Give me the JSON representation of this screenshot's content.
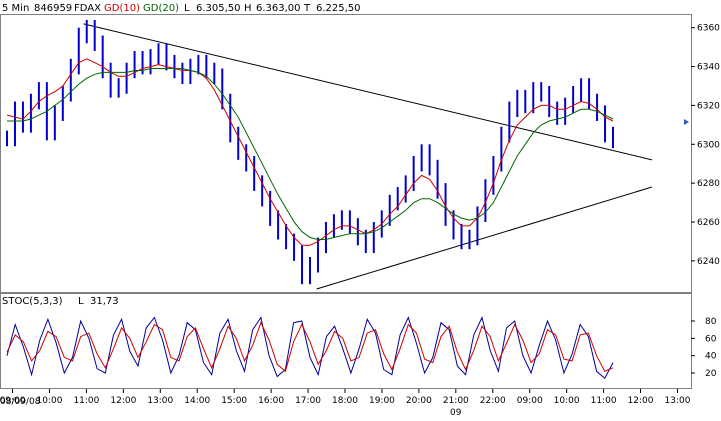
{
  "header": {
    "interval": "5 Min",
    "code": "846959",
    "symbol": "FDAX",
    "ma_fast_label": "GD(10)",
    "ma_slow_label": "GD(20)",
    "low_label": "L",
    "low_value": "6.305,50",
    "high_label": "H",
    "high_value": "6.363,00",
    "last_label": "T",
    "last_value": "6.225,50"
  },
  "stoch_header": {
    "label": "STOC(5,3,3)",
    "last_label": "L",
    "last_value": "31,73"
  },
  "colors": {
    "price": "#0000cc",
    "ma_fast": "#cc0000",
    "ma_slow": "#006600",
    "stoch_k": "#000099",
    "stoch_d": "#cc0000",
    "trendline": "#000000",
    "marker": "#3355cc"
  },
  "date_labels": {
    "left": "08/09/08",
    "mid": "09"
  },
  "chart_data": [
    {
      "type": "line",
      "title": "",
      "x": [
        "09:00",
        "10:00",
        "11:00",
        "12:00",
        "13:00",
        "14:00",
        "15:00",
        "16:00",
        "17:00",
        "18:00",
        "19:00",
        "20:00",
        "21:00",
        "22:00",
        "09:00",
        "10:00",
        "11:00",
        "12:00",
        "13:00"
      ],
      "series": [
        {
          "name": "FDAX",
          "style": "price",
          "values": [
            6303,
            6318,
            6310,
            6322,
            6328,
            6306,
            6316,
            6326,
            6340,
            6356,
            6360,
            6352,
            6338,
            6328,
            6330,
            6338,
            6344,
            6340,
            6345,
            6348,
            6342,
            6338,
            6335,
            6340,
            6342,
            6338,
            6335,
            6322,
            6305,
            6296,
            6290,
            6280,
            6272,
            6262,
            6255,
            6250,
            6244,
            6232,
            6238,
            6248,
            6256,
            6260,
            6262,
            6258,
            6252,
            6248,
            6256,
            6262,
            6270,
            6274,
            6280,
            6290,
            6296,
            6288,
            6276,
            6262,
            6255,
            6250,
            6252,
            6264,
            6278,
            6290,
            6305,
            6318,
            6324,
            6320,
            6328,
            6326,
            6318,
            6314,
            6320,
            6326,
            6330,
            6322,
            6316,
            6305,
            6302
          ]
        },
        {
          "name": "GD(10)",
          "style": "ma_fast",
          "values": [
            6315,
            6314,
            6313,
            6317,
            6322,
            6325,
            6327,
            6330,
            6336,
            6342,
            6344,
            6342,
            6340,
            6337,
            6335,
            6335,
            6337,
            6339,
            6340,
            6341,
            6340,
            6339,
            6338,
            6338,
            6337,
            6334,
            6328,
            6320,
            6312,
            6304,
            6296,
            6288,
            6280,
            6272,
            6265,
            6258,
            6252,
            6248,
            6248,
            6250,
            6253,
            6256,
            6258,
            6258,
            6256,
            6254,
            6256,
            6259,
            6264,
            6268,
            6274,
            6280,
            6284,
            6282,
            6276,
            6268,
            6262,
            6258,
            6258,
            6262,
            6270,
            6280,
            6292,
            6302,
            6310,
            6314,
            6318,
            6320,
            6320,
            6318,
            6318,
            6320,
            6322,
            6321,
            6318,
            6314,
            6312
          ]
        },
        {
          "name": "GD(20)",
          "style": "ma_slow",
          "values": [
            6312,
            6312,
            6312,
            6313,
            6315,
            6317,
            6320,
            6323,
            6327,
            6331,
            6334,
            6336,
            6337,
            6337,
            6337,
            6337,
            6338,
            6338,
            6339,
            6339,
            6339,
            6339,
            6339,
            6338,
            6337,
            6335,
            6331,
            6326,
            6320,
            6314,
            6306,
            6298,
            6290,
            6282,
            6274,
            6267,
            6260,
            6255,
            6252,
            6251,
            6251,
            6252,
            6253,
            6254,
            6254,
            6254,
            6255,
            6257,
            6260,
            6263,
            6266,
            6270,
            6272,
            6272,
            6270,
            6267,
            6264,
            6262,
            6261,
            6262,
            6265,
            6270,
            6278,
            6286,
            6294,
            6300,
            6306,
            6310,
            6312,
            6313,
            6314,
            6316,
            6318,
            6318,
            6317,
            6315,
            6313
          ]
        }
      ],
      "ylim": [
        6225,
        6365
      ],
      "yticks": [
        6240,
        6260,
        6280,
        6300,
        6320,
        6340,
        6360
      ],
      "trendlines": [
        {
          "name": "upper",
          "from": {
            "t": 14,
            "v": 6362
          },
          "to": {
            "t": 114,
            "v": 6292
          }
        },
        {
          "name": "lower",
          "from": {
            "t": 55,
            "v": 6225.5
          },
          "to": {
            "t": 114,
            "v": 6278
          }
        }
      ],
      "grid": false,
      "legend": "top-left"
    },
    {
      "type": "line",
      "title": "",
      "x": [
        "09:00",
        "10:00",
        "11:00",
        "12:00",
        "13:00",
        "14:00",
        "15:00",
        "16:00",
        "17:00",
        "18:00",
        "19:00",
        "20:00",
        "21:00",
        "22:00",
        "09:00",
        "10:00",
        "11:00",
        "12:00",
        "13:00"
      ],
      "series": [
        {
          "name": "%K",
          "style": "stoch_k",
          "values": [
            40,
            76,
            50,
            18,
            58,
            82,
            55,
            20,
            38,
            80,
            60,
            25,
            20,
            64,
            82,
            45,
            28,
            72,
            84,
            58,
            20,
            40,
            78,
            70,
            32,
            18,
            66,
            82,
            46,
            22,
            70,
            84,
            40,
            16,
            24,
            78,
            80,
            38,
            18,
            62,
            74,
            48,
            20,
            48,
            82,
            66,
            24,
            18,
            64,
            84,
            54,
            20,
            38,
            78,
            70,
            28,
            18,
            64,
            84,
            46,
            22,
            72,
            80,
            40,
            20,
            52,
            80,
            58,
            20,
            42,
            76,
            62,
            22,
            14,
            32
          ]
        },
        {
          "name": "%D",
          "style": "stoch_d",
          "values": [
            44,
            64,
            56,
            34,
            46,
            68,
            62,
            38,
            34,
            62,
            66,
            42,
            26,
            48,
            72,
            60,
            38,
            56,
            76,
            70,
            38,
            34,
            62,
            72,
            48,
            26,
            48,
            74,
            60,
            34,
            52,
            78,
            58,
            30,
            22,
            56,
            76,
            56,
            30,
            46,
            68,
            60,
            34,
            38,
            66,
            70,
            42,
            24,
            48,
            76,
            66,
            36,
            32,
            62,
            74,
            44,
            24,
            46,
            74,
            62,
            34,
            54,
            76,
            58,
            32,
            42,
            70,
            64,
            36,
            34,
            64,
            66,
            40,
            22,
            26
          ]
        }
      ],
      "ylim": [
        5,
        95
      ],
      "yticks": [
        20,
        40,
        60,
        80
      ],
      "grid": false
    }
  ]
}
